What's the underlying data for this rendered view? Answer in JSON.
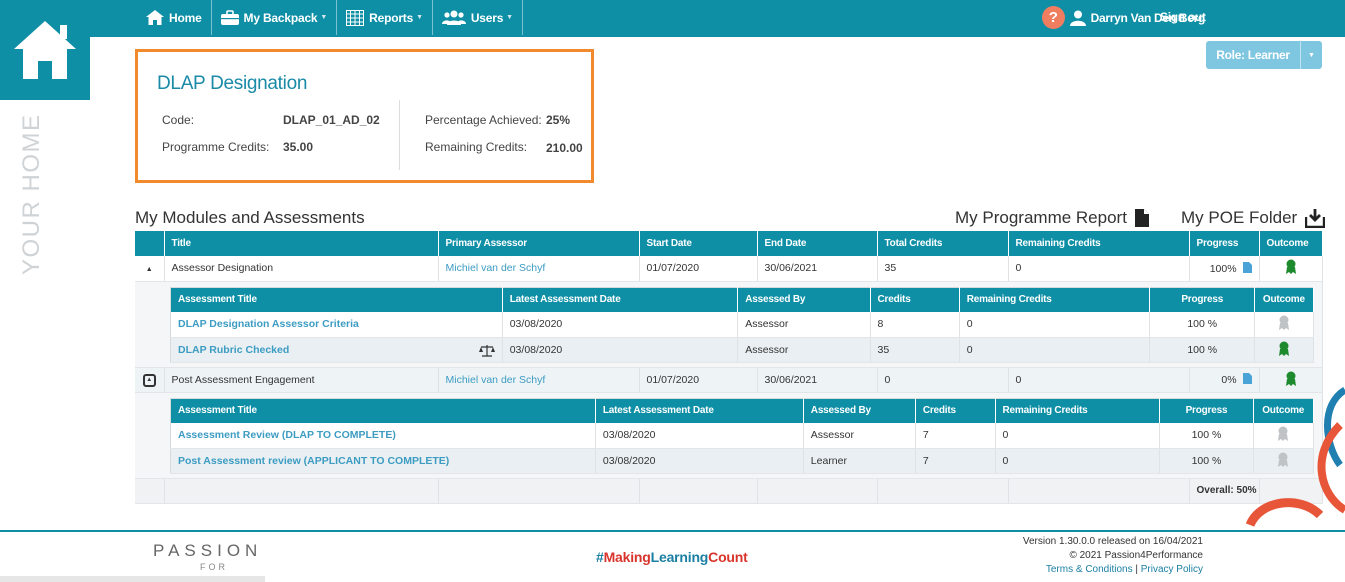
{
  "nav": {
    "home": "Home",
    "backpack": "My Backpack",
    "reports": "Reports",
    "users": "Users",
    "user_name": "Darryn Van Den Berg",
    "sign_out": "Sign out"
  },
  "sidebar": {
    "vertical_label": "YOUR HOME"
  },
  "role": {
    "label": "Role: Learner"
  },
  "designation": {
    "title": "DLAP Designation",
    "code_label": "Code:",
    "code_value": "DLAP_01_AD_02",
    "credits_label": "Programme Credits:",
    "credits_value": "35.00",
    "pct_label": "Percentage Achieved:",
    "pct_value": "25%",
    "remaining_label": "Remaining Credits:",
    "remaining_value": "210.00"
  },
  "section": {
    "title": "My Modules and Assessments",
    "report_link": "My Programme Report",
    "poe_link": "My POE Folder"
  },
  "modules_table": {
    "headers": [
      "",
      "Title",
      "Primary Assessor",
      "Start Date",
      "End Date",
      "Total Credits",
      "Remaining Credits",
      "Progress",
      "Outcome"
    ],
    "modules": [
      {
        "title": "Assessor Designation",
        "assessor": "Michiel van der Schyf",
        "start": "01/07/2020",
        "end": "30/06/2021",
        "total": "35",
        "remaining": "0",
        "progress": "100%",
        "sub_headers": [
          "Assessment Title",
          "Latest Assessment Date",
          "Assessed By",
          "Credits",
          "Remaining Credits",
          "Progress",
          "Outcome"
        ],
        "assessments": [
          {
            "title": "DLAP Designation Assessor Criteria",
            "date": "03/08/2020",
            "by": "Assessor",
            "credits": "8",
            "remaining": "0",
            "progress": "100 %"
          },
          {
            "title": "DLAP Rubric Checked",
            "date": "03/08/2020",
            "by": "Assessor",
            "credits": "35",
            "remaining": "0",
            "progress": "100 %"
          }
        ]
      },
      {
        "title": "Post Assessment Engagement",
        "assessor": "Michiel van der Schyf",
        "start": "01/07/2020",
        "end": "30/06/2021",
        "total": "0",
        "remaining": "0",
        "progress": "0%",
        "sub_headers": [
          "Assessment Title",
          "Latest Assessment Date",
          "Assessed By",
          "Credits",
          "Remaining Credits",
          "Progress",
          "Outcome"
        ],
        "assessments": [
          {
            "title": "Assessment Review (DLAP TO COMPLETE)",
            "date": "03/08/2020",
            "by": "Assessor",
            "credits": "7",
            "remaining": "0",
            "progress": "100 %"
          },
          {
            "title": "Post Assessment review (APPLICANT TO COMPLETE)",
            "date": "03/08/2020",
            "by": "Learner",
            "credits": "7",
            "remaining": "0",
            "progress": "100 %"
          }
        ]
      }
    ],
    "overall": "Overall: 50%"
  },
  "footer": {
    "logo": "PASSION",
    "logo_sub": "FOR",
    "tag_hash": "#",
    "tag_making": "Making",
    "tag_learning": "Learning",
    "tag_count": "Count",
    "version": "Version 1.30.0.0 released on 16/04/2021",
    "copyright": "© 2021 Passion4Performance",
    "terms": "Terms & Conditions",
    "sep": "|",
    "privacy": "Privacy Policy"
  },
  "colors": {
    "primary": "#0e8fa6",
    "accent_orange": "#f08a2c",
    "link": "#3c9cc2",
    "award_green": "#1e8a2e",
    "award_grey": "#bfc3c6"
  }
}
